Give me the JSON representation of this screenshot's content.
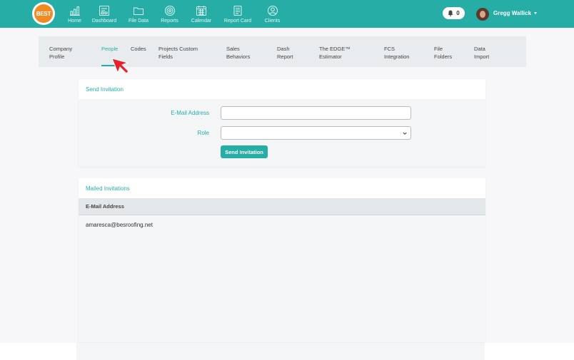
{
  "brand": {
    "logo_text": "BEST",
    "accent": "#26aea6"
  },
  "nav": {
    "items": [
      {
        "label": "Home",
        "icon": "bar-chart-icon"
      },
      {
        "label": "Dashboard",
        "icon": "dashboard-icon"
      },
      {
        "label": "File Data",
        "icon": "folder-icon"
      },
      {
        "label": "Reports",
        "icon": "target-icon"
      },
      {
        "label": "Calendar",
        "icon": "calendar-icon"
      },
      {
        "label": "Report Card",
        "icon": "report-card-icon"
      },
      {
        "label": "Clients",
        "icon": "user-circle-icon"
      }
    ]
  },
  "header": {
    "notification_count": "0",
    "user_name": "Gregg Wallick"
  },
  "tabs": [
    {
      "line1": "Company",
      "line2": "Profile"
    },
    {
      "line1": "People",
      "line2": ""
    },
    {
      "line1": "Codes",
      "line2": ""
    },
    {
      "line1": "Projects Custom",
      "line2": "Fields"
    },
    {
      "line1": "Sales",
      "line2": "Behaviors"
    },
    {
      "line1": "Dash",
      "line2": "Report"
    },
    {
      "line1": "The EDGE™",
      "line2": "Estimator"
    },
    {
      "line1": "FCS",
      "line2": "Integration"
    },
    {
      "line1": "File",
      "line2": "Folders"
    },
    {
      "line1": "Data",
      "line2": "Import"
    }
  ],
  "invite": {
    "title": "Send Invitation",
    "email_label": "E-Mail Address",
    "email_value": "",
    "role_label": "Role",
    "role_value": "",
    "button_label": "Send Invitation"
  },
  "mailed": {
    "title": "Mailed Invitations",
    "columns": [
      "E-Mail Address"
    ],
    "rows": [
      [
        "amaresca@besroofing.net"
      ]
    ]
  }
}
